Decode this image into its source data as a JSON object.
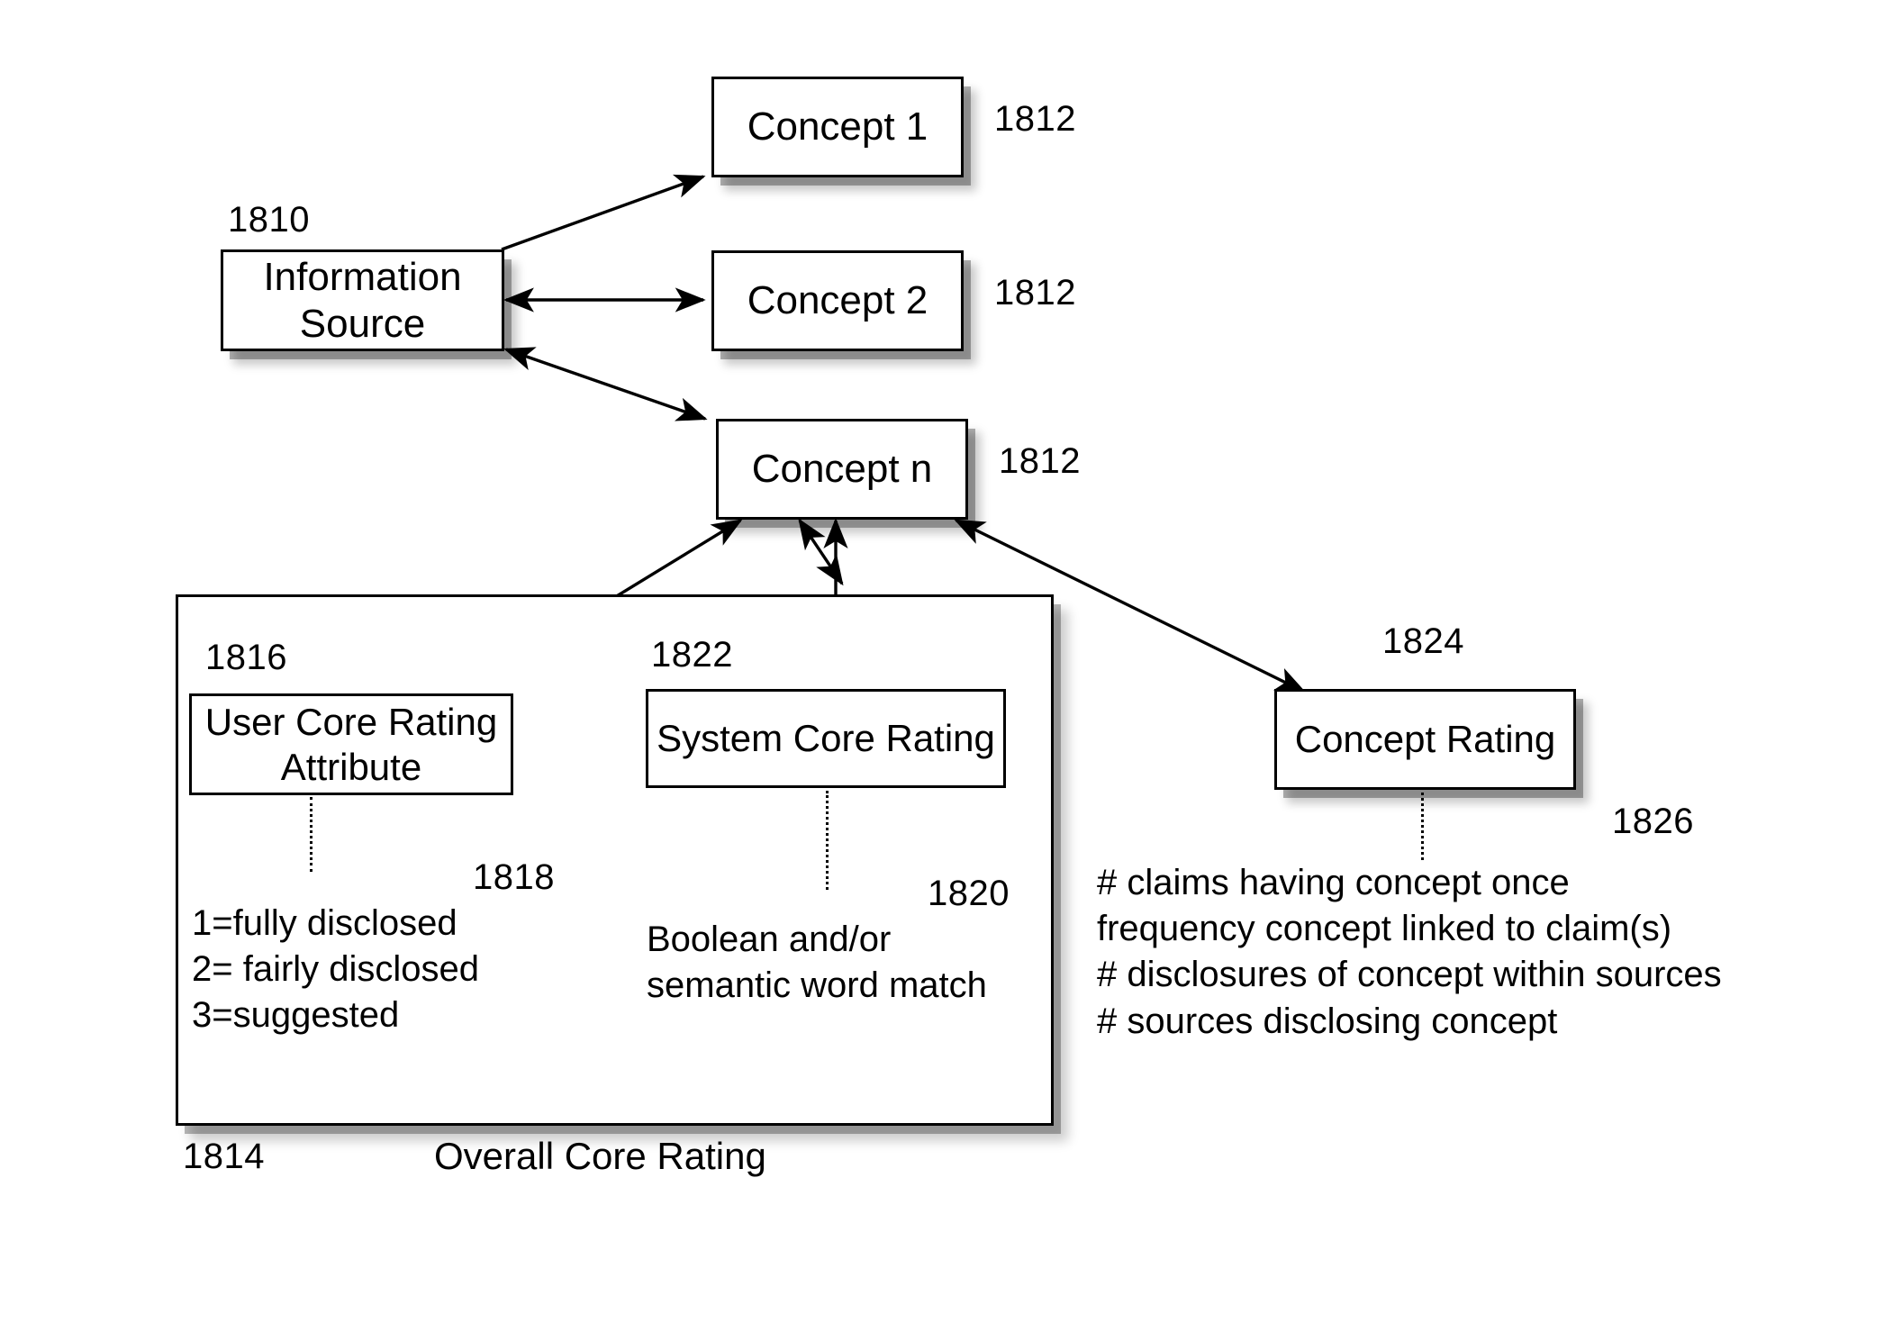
{
  "figure": {
    "caption": "Overall Core Rating",
    "caption_ref": "1814"
  },
  "nodes": {
    "information_source": {
      "label": "Information\nSource",
      "ref": "1810"
    },
    "concept_1": {
      "label": "Concept 1",
      "ref": "1812"
    },
    "concept_2": {
      "label": "Concept 2",
      "ref": "1812"
    },
    "concept_n": {
      "label": "Concept n",
      "ref": "1812"
    },
    "user_core_rating": {
      "label": "User Core Rating\nAttribute",
      "ref": "1816"
    },
    "system_core_rating": {
      "label": "System Core Rating",
      "ref": "1822"
    },
    "concept_rating": {
      "label": "Concept Rating",
      "ref": "1824"
    }
  },
  "annotations": {
    "user_rating_scale": {
      "ref": "1818",
      "text": "1=fully disclosed\n2= fairly disclosed\n3=suggested"
    },
    "system_rating_method": {
      "ref": "1820",
      "text": "Boolean and/or\nsemantic word match"
    },
    "concept_rating_metrics": {
      "ref": "1826",
      "text": "# claims having concept once\nfrequency concept linked to claim(s)\n# disclosures of concept within sources\n# sources disclosing concept"
    }
  },
  "colors": {
    "stroke": "#000000",
    "fill": "#ffffff"
  }
}
